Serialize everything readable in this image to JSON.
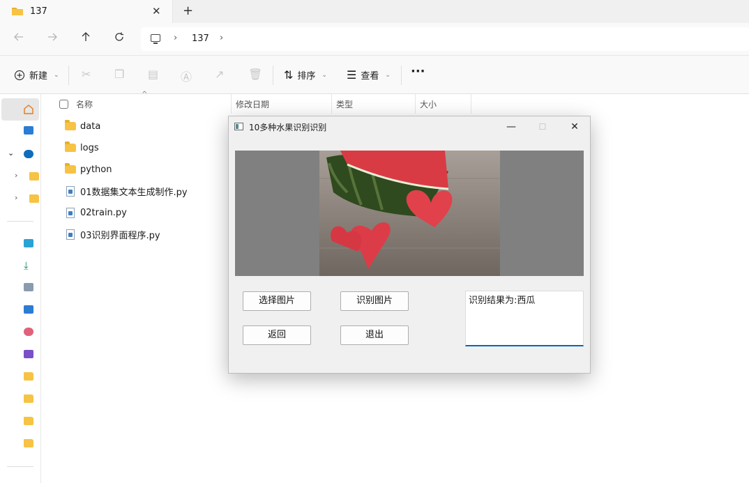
{
  "tab": {
    "title": "137",
    "close_glyph": "✕",
    "new_glyph": "+"
  },
  "nav": {
    "breadcrumb": [
      "137"
    ],
    "chevron": "›"
  },
  "commandbar": {
    "new_label": "新建",
    "sort_label": "排序",
    "view_label": "查看",
    "more_glyph": "···"
  },
  "columns": {
    "name": "名称",
    "modified": "修改日期",
    "type": "类型",
    "size": "大小"
  },
  "files": [
    {
      "name": "data",
      "kind": "folder"
    },
    {
      "name": "logs",
      "kind": "folder"
    },
    {
      "name": "python",
      "kind": "folder"
    },
    {
      "name": "01数据集文本生成制作.py",
      "kind": "py"
    },
    {
      "name": "02train.py",
      "kind": "py"
    },
    {
      "name": "03识别界面程序.py",
      "kind": "py"
    }
  ],
  "dialog": {
    "title": "10多种水果识别识别",
    "buttons": {
      "select": "选择图片",
      "recognize": "识别图片",
      "back": "返回",
      "exit": "退出"
    },
    "result_text": "识别结果为:西瓜"
  },
  "colors": {
    "folder": "#f6c344",
    "accent": "#0067c0",
    "image_bg": "#808080"
  }
}
